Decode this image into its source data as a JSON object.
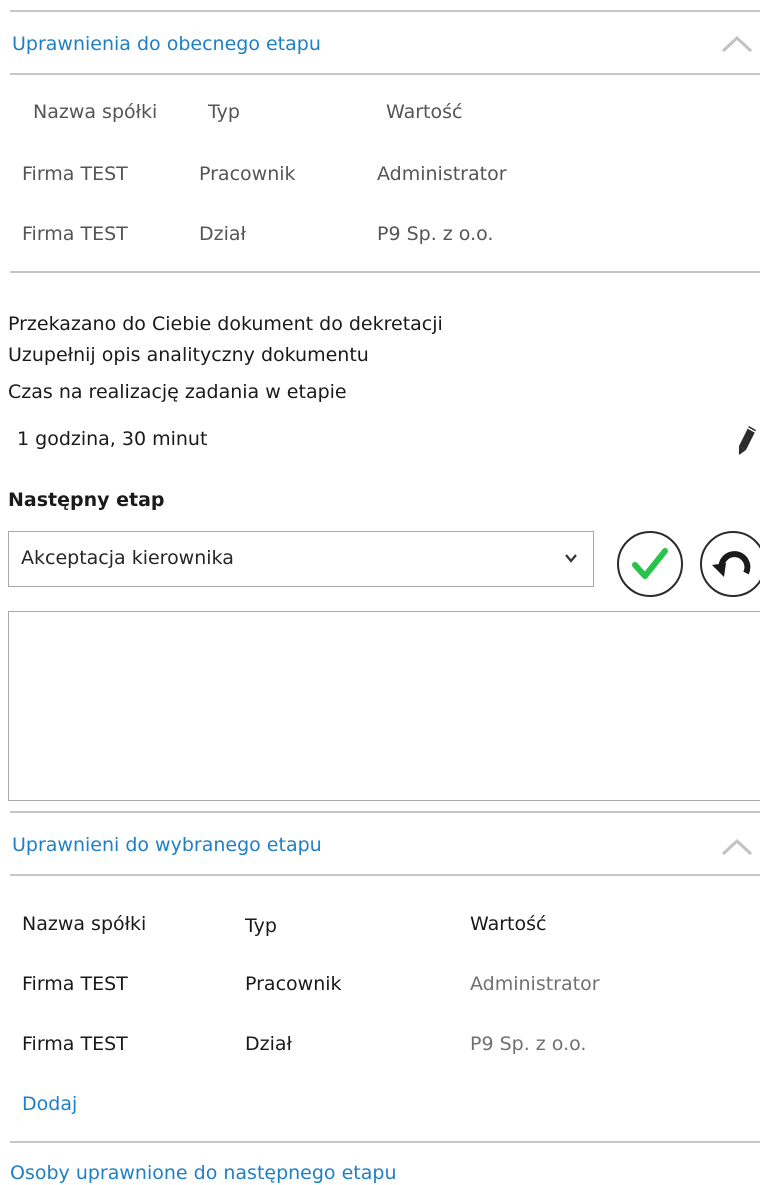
{
  "current_stage_section": {
    "title": "Uprawnienia do obecnego etapu",
    "columns": [
      "Nazwa spółki",
      "Typ",
      "Wartość"
    ],
    "rows": [
      [
        "Firma TEST",
        "Pracownik",
        "Administrator"
      ],
      [
        "Firma TEST",
        "Dział",
        "P9 Sp. z o.o."
      ]
    ]
  },
  "info": {
    "message_line1": "Przekazano do Ciebie dokument do dekretacji",
    "message_line2": "Uzupełnij opis analityczny dokumentu",
    "time_label": "Czas na realizację zadania w etapie",
    "time_value": "1 godzina, 30 minut"
  },
  "next_stage": {
    "label": "Następny etap",
    "selected": "Akceptacja kierownika",
    "comment": ""
  },
  "selected_stage_section": {
    "title": "Uprawnieni do wybranego etapu",
    "columns": [
      "Nazwa spółki",
      "Typ",
      "Wartość"
    ],
    "rows": [
      [
        "Firma TEST",
        "Pracownik",
        "Administrator"
      ],
      [
        "Firma TEST",
        "Dział",
        "P9 Sp. z o.o."
      ]
    ],
    "add_label": "Dodaj"
  },
  "persons_section": {
    "title": "Osoby uprawnione do następnego etapu"
  },
  "colors": {
    "link_blue": "#1f7fc5",
    "accept_green": "#26c44b",
    "rule_gray": "#c6c6c6"
  },
  "icons": {
    "collapse": "chevron-up-icon",
    "edit": "pencil-icon",
    "accept": "check-circle-icon",
    "undo": "undo-circle-icon",
    "dropdown": "chevron-down-icon"
  }
}
